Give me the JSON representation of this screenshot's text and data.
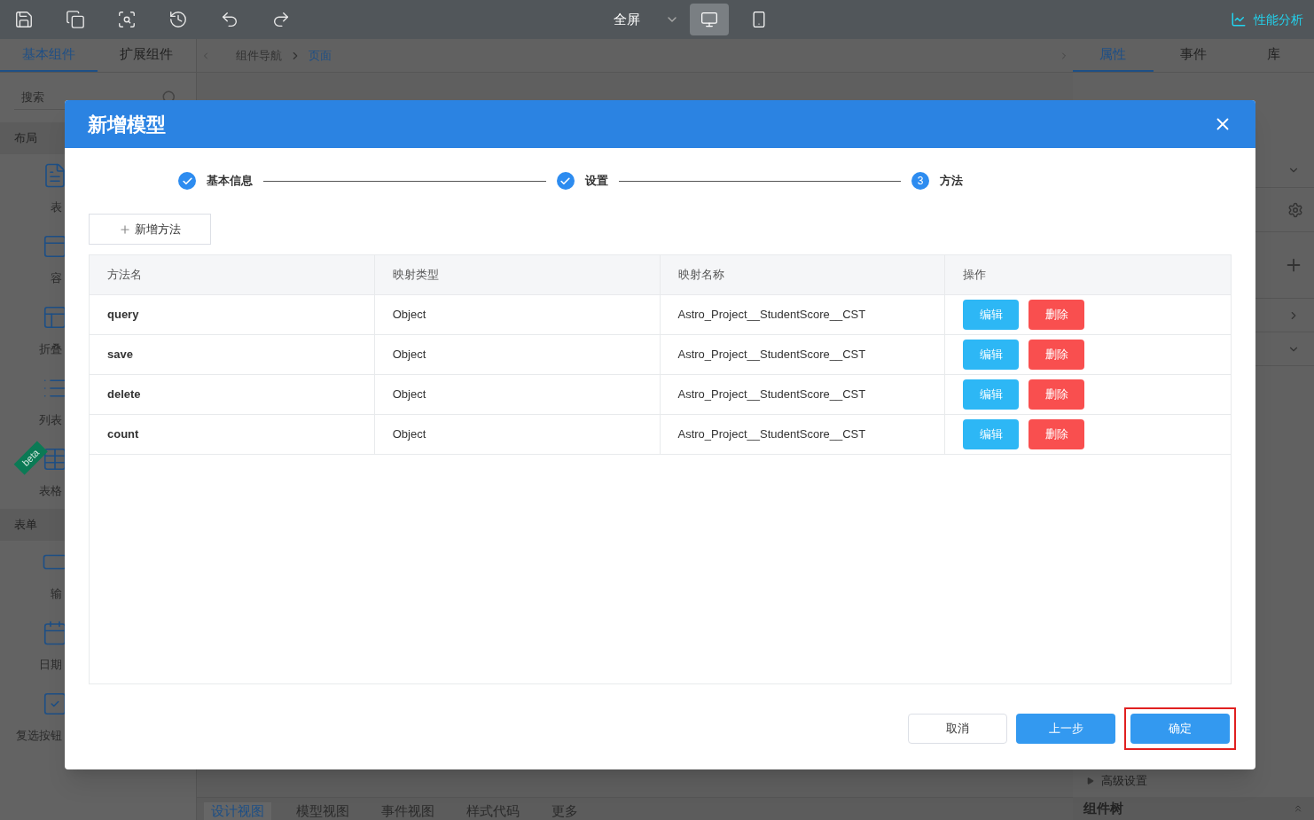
{
  "toolbar": {
    "view_mode": "全屏",
    "devices": [
      {
        "kind": "desktop",
        "selected": true
      },
      {
        "kind": "mobile",
        "selected": false
      }
    ],
    "performance": "性能分析"
  },
  "left_panel": {
    "tabs": [
      {
        "label": "基本组件",
        "selected": true
      },
      {
        "label": "扩展组件",
        "selected": false
      }
    ],
    "search": {
      "placeholder": "搜索"
    },
    "sections": [
      {
        "title": "布局",
        "items": [
          {
            "label": "表",
            "kind": "form"
          },
          {
            "label": "容",
            "kind": "container"
          },
          {
            "label": "折叠",
            "kind": "collapse"
          },
          {
            "label": "列表",
            "kind": "list"
          },
          {
            "label": "表格",
            "kind": "table",
            "badge": "beta"
          }
        ]
      },
      {
        "title": "表单",
        "items": [
          {
            "label": "输",
            "kind": "input"
          },
          {
            "label": "日期",
            "kind": "date"
          },
          {
            "label": "复选按钮",
            "kind": "checkbox"
          }
        ]
      }
    ]
  },
  "breadcrumb": [
    {
      "label": "组件导航",
      "selected": false
    },
    {
      "label": "页面",
      "selected": true
    }
  ],
  "right_panel": {
    "tabs": [
      {
        "label": "属性",
        "selected": true
      },
      {
        "label": "事件",
        "selected": false
      },
      {
        "label": "库",
        "selected": false
      }
    ],
    "advanced": "高级设置",
    "tree_title": "组件树"
  },
  "bottom_tabs": [
    {
      "label": "设计视图",
      "selected": true
    },
    {
      "label": "模型视图",
      "selected": false
    },
    {
      "label": "事件视图",
      "selected": false
    },
    {
      "label": "样式代码",
      "selected": false
    },
    {
      "label": "更多",
      "selected": false
    }
  ],
  "dialog": {
    "title": "新增模型",
    "steps": [
      {
        "label": "基本信息",
        "done": true
      },
      {
        "label": "设置",
        "done": true
      },
      {
        "label": "方法",
        "done": false,
        "number": "3"
      }
    ],
    "add_button": "新增方法",
    "table": {
      "columns": [
        "方法名",
        "映射类型",
        "映射名称",
        "操作"
      ],
      "rows": [
        {
          "name": "query",
          "type": "Object",
          "mapping": "Astro_Project__StudentScore__CST",
          "actions": [
            "编辑",
            "删除"
          ]
        },
        {
          "name": "save",
          "type": "Object",
          "mapping": "Astro_Project__StudentScore__CST",
          "actions": [
            "编辑",
            "删除"
          ]
        },
        {
          "name": "delete",
          "type": "Object",
          "mapping": "Astro_Project__StudentScore__CST",
          "actions": [
            "编辑",
            "删除"
          ]
        },
        {
          "name": "count",
          "type": "Object",
          "mapping": "Astro_Project__StudentScore__CST",
          "actions": [
            "编辑",
            "删除"
          ]
        }
      ]
    },
    "buttons": [
      {
        "label": "取消",
        "kind": "default",
        "highlighted": false
      },
      {
        "label": "上一步",
        "kind": "primary",
        "highlighted": false
      },
      {
        "label": "确定",
        "kind": "primary",
        "highlighted": true
      }
    ]
  }
}
